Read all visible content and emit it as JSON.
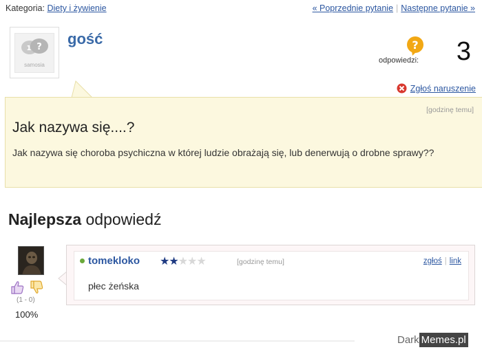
{
  "breadcrumb": {
    "category_label": "Kategoria:",
    "category_link": "Diety i żywienie",
    "prev_link": "« Poprzednie pytanie",
    "separator": "|",
    "next_link": "Następne pytanie »"
  },
  "question": {
    "author": "gość",
    "avatar_caption": "samosia",
    "answers_label": "odpowiedzi:",
    "answers_count": "3",
    "report_link": "Zgłoś naruszenie",
    "time": "[godzinę temu]",
    "title": "Jak nazywa się....?",
    "body": "Jak nazywa się choroba psychiczna w której ludzie obrażają się, lub denerwują o drobne sprawy??"
  },
  "best_answer": {
    "heading_bold": "Najlepsza",
    "heading_rest": " odpowiedź",
    "author": "tomekloko",
    "rating": {
      "filled": 2,
      "total": 5
    },
    "time": "[godzinę temu]",
    "report_link": "zgłoś",
    "link_label": "link",
    "links_separator": "|",
    "text": "płec żeńska",
    "votes_ratio": "(1 - 0)",
    "votes_percent": "100%"
  },
  "watermark": {
    "part1": "Dark",
    "part2": "Memes.pl"
  },
  "colors": {
    "link": "#2b56a0",
    "username": "#3a6aa8",
    "question_bg": "#fcf8df",
    "answer_bg": "#fdf6f7",
    "star_on": "#1e3a82",
    "online_dot": "#6aa93b"
  }
}
